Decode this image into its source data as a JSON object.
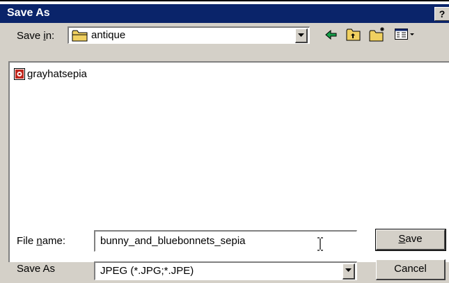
{
  "window": {
    "title": "Save As",
    "help_label": "?"
  },
  "save_in": {
    "label_prefix": "Save ",
    "label_hotkey": "i",
    "label_suffix": "n:",
    "selected": "antique"
  },
  "toolbar": {
    "icons": [
      "back-arrow-icon",
      "up-one-level-icon",
      "create-new-folder-icon",
      "view-menu-icon"
    ]
  },
  "file_list": {
    "items": [
      {
        "name": "grayhatsepia",
        "icon": "image-file-icon"
      }
    ]
  },
  "file_name": {
    "label_prefix": "File ",
    "label_hotkey": "n",
    "label_suffix": "ame:",
    "value": "bunny_and_bluebonnets_sepia"
  },
  "save_as_type": {
    "label": "Save As",
    "selected": "JPEG (*.JPG;*.JPE)"
  },
  "buttons": {
    "save_hotkey": "S",
    "save_rest": "ave",
    "cancel": "Cancel"
  },
  "colors": {
    "titlebar": "#0a246a",
    "face": "#d4d0c8",
    "folder": "#f0d060"
  }
}
